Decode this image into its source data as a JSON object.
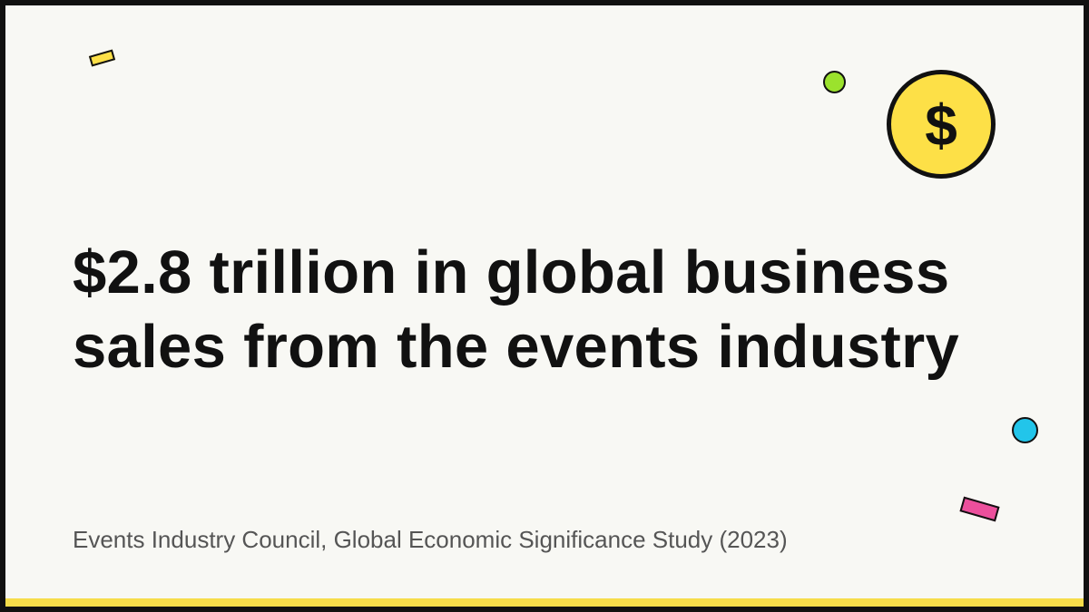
{
  "headline": {
    "line1": "$2.8 trillion in global business",
    "line2": "sales from the events industry"
  },
  "source": "Events Industry Council, Global Economic Significance Study (2023)",
  "coin": {
    "icon": "dollar-coin-icon",
    "glyph": "$"
  },
  "colors": {
    "background": "#f8f8f4",
    "border": "#111111",
    "text": "#111111",
    "source_text": "#555555",
    "coin_fill": "#fde047",
    "bottom_stripe": "#f7dd4a",
    "confetti_yellow": "#fde047",
    "confetti_green": "#9be22d",
    "confetti_cyan": "#22c5ea",
    "confetti_pink": "#ec4f9c"
  }
}
